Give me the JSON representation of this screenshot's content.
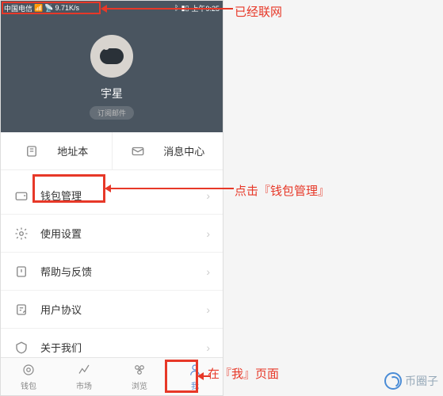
{
  "status_bar": {
    "carrier": "中国电信",
    "speed": "9.71K/s",
    "bluetooth": "⚙",
    "battery_pct": "",
    "time": "上午9:25"
  },
  "profile": {
    "username": "宇星",
    "subscribe": "订阅邮件"
  },
  "quick": {
    "address_book": "地址本",
    "message_center": "消息中心"
  },
  "menu": {
    "wallet_mgmt": "钱包管理",
    "settings": "使用设置",
    "help_feedback": "帮助与反馈",
    "user_agreement": "用户协议",
    "about_us": "关于我们"
  },
  "nav": {
    "wallet": "钱包",
    "market": "市场",
    "browse": "浏览",
    "me": "我"
  },
  "annotations": {
    "connected": "已经联网",
    "click_wallet": "点击『钱包管理』",
    "on_me_page": "在『我』页面"
  },
  "watermark": "币圈子"
}
